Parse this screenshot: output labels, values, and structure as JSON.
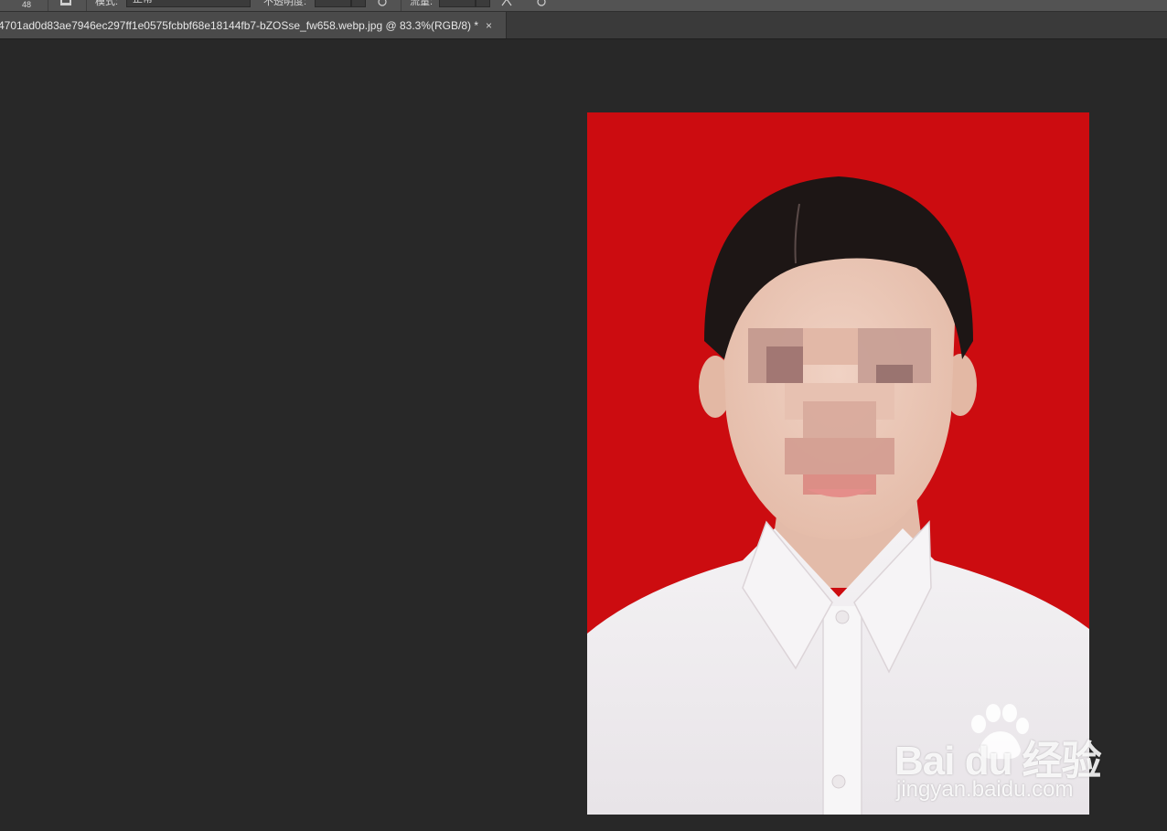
{
  "options_bar": {
    "size_value": "48",
    "mode_label": "模式:",
    "mode_value": "正常",
    "opacity_label": "不透明度:",
    "flow_label": "流量:"
  },
  "document_tab": {
    "title": "4701ad0d83ae7946ec297ff1e0575fcbbf68e18144fb7-bZOSse_fw658.webp.jpg @ 83.3%(RGB/8) *",
    "close_glyph": "×"
  },
  "canvas": {
    "background": "#282828",
    "photo_background": "#cc0c10"
  },
  "watermark": {
    "logo_text": "Bai  du 经验",
    "url": "jingyan.baidu.com",
    "icon": "baidu-paw-icon"
  }
}
